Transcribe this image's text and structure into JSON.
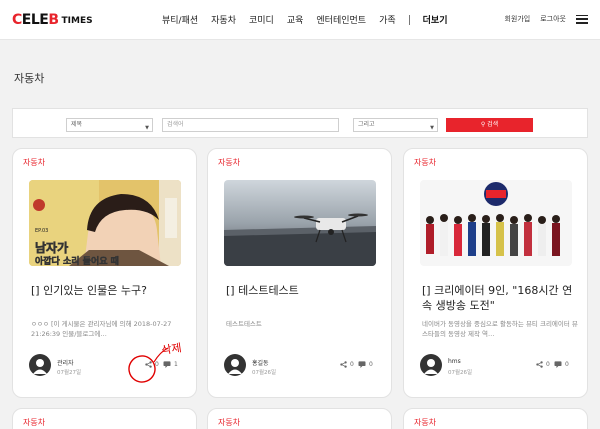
{
  "header": {
    "logo_mark": "CELEB",
    "logo_sub": "TIMES",
    "nav": [
      "뷰티/패션",
      "자동차",
      "코미디",
      "교육",
      "엔터테인먼트",
      "가족"
    ],
    "nav_more": "더보기",
    "links": {
      "join": "회원가입",
      "login": "로그아웃"
    }
  },
  "page": {
    "title": "자동차"
  },
  "search": {
    "field_select": "제목",
    "keyword_placeholder": "검색어",
    "operator_select": "그리고",
    "button_label": "검색"
  },
  "cards": [
    {
      "category": "자동차",
      "thumb_caption": "남자가",
      "thumb_caption2": "아깝다 소리 들어요 때",
      "thumb_badge": "EP.03",
      "title": "[] 인기있는 인물은 누구?",
      "excerpt": "ㅇㅇㅇ [이 게시물은 관리자님에 의해 2018-07-27 21:26:39 인물/블로그에…",
      "author": "관리자",
      "date": "07월27일",
      "shares": "0",
      "comments": "1"
    },
    {
      "category": "자동차",
      "title": "[] 테스트테스트",
      "excerpt": "테스트테스트",
      "author": "홍길동",
      "date": "07월26일",
      "shares": "0",
      "comments": "0"
    },
    {
      "category": "자동차",
      "title": "[] 크리에이터 9인, \"168시간 연속 생방송 도전\"",
      "excerpt": "네이버가 동영상을 중심으로 활동하는 뷰티 크리에이터 뷰스타들의 동영상 제작 역…",
      "author": "hms",
      "date": "07월26일",
      "shares": "0",
      "comments": "0"
    }
  ],
  "row2_categories": [
    "자동차",
    "자동차",
    "자동차"
  ],
  "annotation": "삭제",
  "colors": {
    "accent": "#e8242c",
    "annotation": "#e00000"
  }
}
